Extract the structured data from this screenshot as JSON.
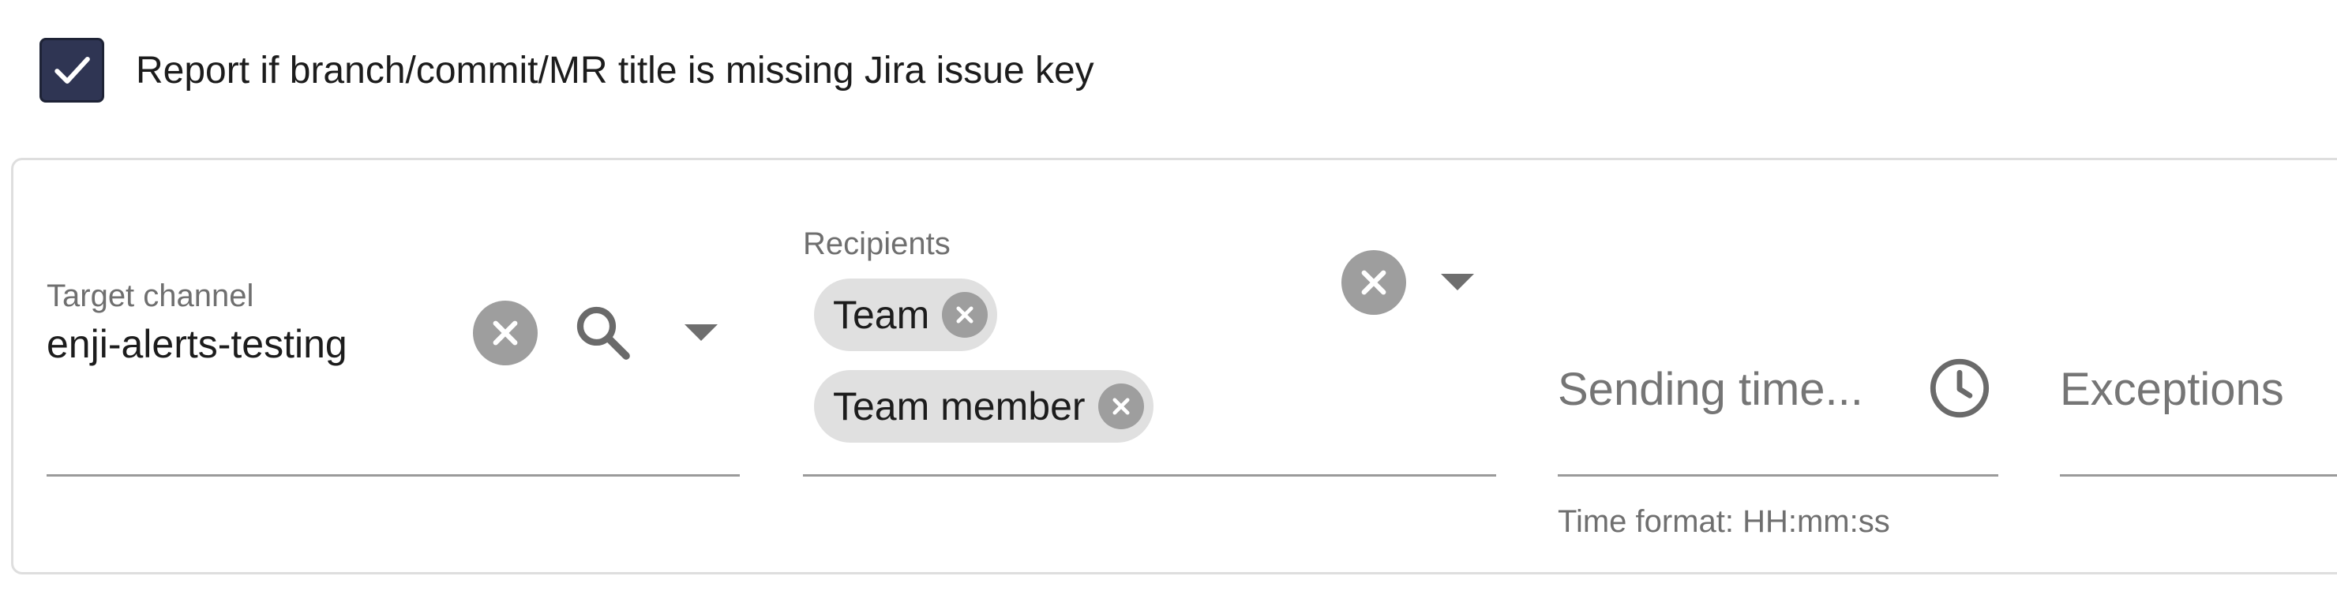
{
  "report_missing_key": {
    "checked": true,
    "label": "Report if branch/commit/MR title is missing Jira issue key"
  },
  "target_channel": {
    "label": "Target channel",
    "value": "enji-alerts-testing"
  },
  "recipients": {
    "label": "Recipients",
    "chips": [
      {
        "label": "Team"
      },
      {
        "label": "Team member"
      }
    ]
  },
  "sending_time": {
    "placeholder": "Sending time...",
    "helper": "Time format: HH:mm:ss"
  },
  "exceptions": {
    "placeholder": "Exceptions"
  },
  "colors": {
    "checkbox_fill": "#2f3553",
    "clear_button": "#9e9e9e",
    "chip_background": "#e0e0e0"
  },
  "icons": {
    "checkbox": "check-icon",
    "clear": "close-icon",
    "search": "search-icon",
    "dropdown": "caret-down-icon",
    "time": "clock-icon"
  }
}
